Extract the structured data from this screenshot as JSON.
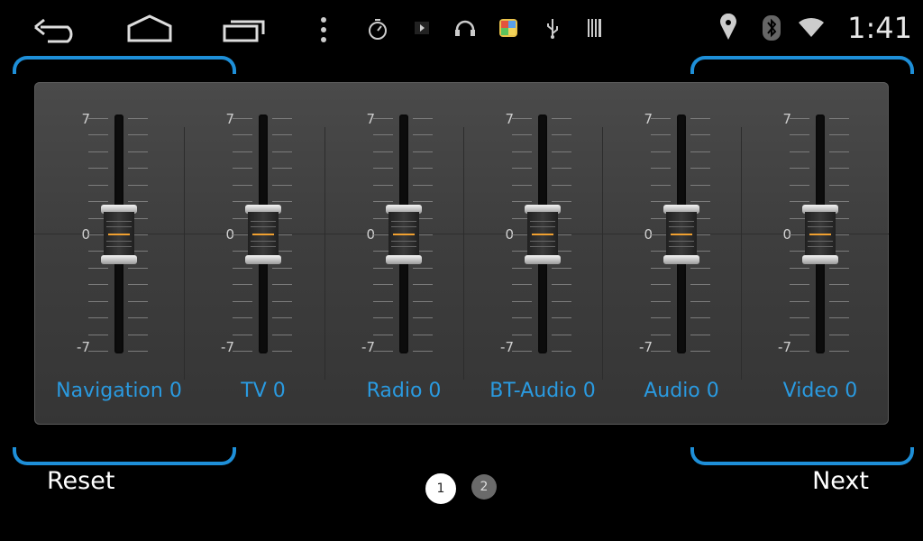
{
  "status_bar": {
    "icons": [
      "back-icon",
      "home-icon",
      "recents-icon",
      "menu-dots-icon",
      "timer-icon",
      "play-icon",
      "headset-icon",
      "app-icon",
      "usb-icon",
      "barcode-icon",
      "location-icon",
      "bluetooth-icon",
      "wifi-icon"
    ],
    "clock": "1:41"
  },
  "equalizer": {
    "scale": {
      "max": "7",
      "mid": "0",
      "min": "-7"
    },
    "channels": [
      {
        "label": "Navigation 0",
        "value": 0
      },
      {
        "label": "TV 0",
        "value": 0
      },
      {
        "label": "Radio 0",
        "value": 0
      },
      {
        "label": "BT-Audio 0",
        "value": 0
      },
      {
        "label": "Audio 0",
        "value": 0
      },
      {
        "label": "Video 0",
        "value": 0
      }
    ]
  },
  "footer": {
    "reset_label": "Reset",
    "next_label": "Next",
    "pages": [
      "1",
      "2"
    ],
    "current_page": "1"
  },
  "colors": {
    "accent": "#1e8fd8",
    "label": "#2a9ae0",
    "knob_marker": "#f0a030"
  }
}
